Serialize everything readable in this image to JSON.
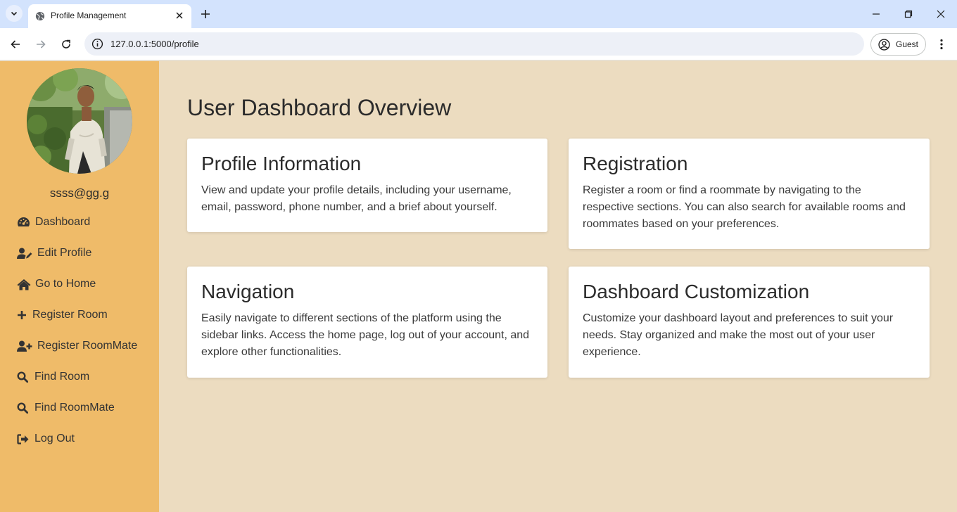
{
  "browser": {
    "tab_title": "Profile Management",
    "url": "127.0.0.1:5000/profile",
    "profile_label": "Guest"
  },
  "sidebar": {
    "username": "ssss@gg.g",
    "items": [
      {
        "label": "Dashboard",
        "icon": "dashboard-gauge-icon"
      },
      {
        "label": "Edit Profile",
        "icon": "user-edit-icon"
      },
      {
        "label": "Go to Home",
        "icon": "home-icon"
      },
      {
        "label": "Register Room",
        "icon": "plus-icon"
      },
      {
        "label": "Register RoomMate",
        "icon": "user-plus-icon"
      },
      {
        "label": "Find Room",
        "icon": "search-icon"
      },
      {
        "label": "Find RoomMate",
        "icon": "search-icon"
      },
      {
        "label": "Log Out",
        "icon": "sign-out-icon"
      }
    ]
  },
  "main": {
    "title": "User Dashboard Overview",
    "cards": [
      {
        "title": "Profile Information",
        "text": "View and update your profile details, including your username, email, password, phone number, and a brief about yourself."
      },
      {
        "title": "Registration",
        "text": "Register a room or find a roommate by navigating to the respective sections. You can also search for available rooms and roommates based on your preferences."
      },
      {
        "title": "Navigation",
        "text": "Easily navigate to different sections of the platform using the sidebar links. Access the home page, log out of your account, and explore other functionalities."
      },
      {
        "title": "Dashboard Customization",
        "text": "Customize your dashboard layout and preferences to suit your needs. Stay organized and make the most out of your user experience."
      }
    ]
  },
  "colors": {
    "sidebar_bg": "#efbb69",
    "main_bg": "#ecdcc0",
    "tabbar_bg": "#d3e3fd"
  }
}
